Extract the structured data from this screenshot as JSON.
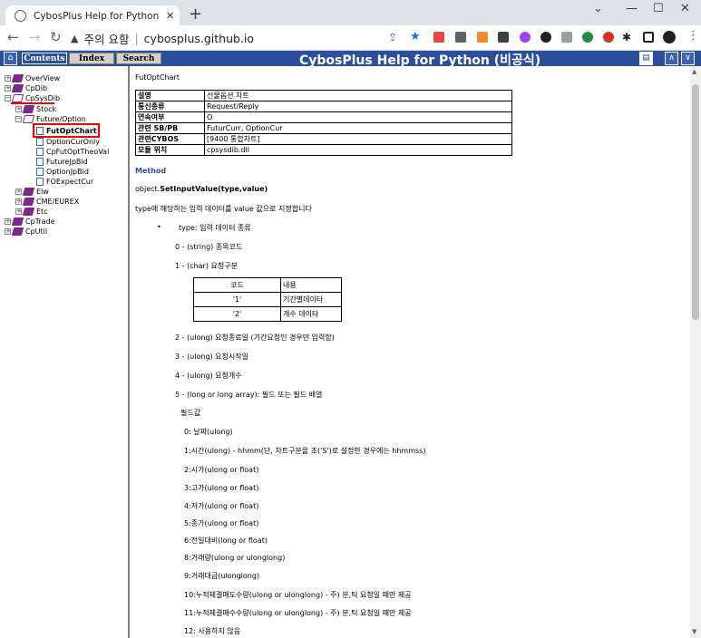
{
  "browser": {
    "tab_title": "CybosPlus Help for Python (비공",
    "tab_close": "✕",
    "new_tab": "+",
    "url_warning": "주의 요함",
    "url": "cybosplus.github.io"
  },
  "help": {
    "tabs": [
      "Contents",
      "Index",
      "Search"
    ],
    "title": "CybosPlus Help for Python (비공식)"
  },
  "tree": [
    {
      "label": "OverView",
      "type": "book",
      "pm": "+"
    },
    {
      "label": "CpDib",
      "type": "book",
      "pm": "+"
    },
    {
      "label": "CpSysDib",
      "type": "open",
      "pm": "−"
    },
    {
      "label": "Stock",
      "type": "book",
      "pm": "+"
    },
    {
      "label": "Future/Option",
      "type": "open",
      "pm": "−"
    },
    {
      "label": "FutOptChart",
      "type": "page"
    },
    {
      "label": "OptionCurOnly",
      "type": "page"
    },
    {
      "label": "CpFutOptTheoVal",
      "type": "page"
    },
    {
      "label": "FutureJpBid",
      "type": "page"
    },
    {
      "label": "OptionJpBid",
      "type": "page"
    },
    {
      "label": "FOExpectCur",
      "type": "page"
    },
    {
      "label": "Elw",
      "type": "book",
      "pm": "+"
    },
    {
      "label": "CME/EUREX",
      "type": "book",
      "pm": "+"
    },
    {
      "label": "Etc",
      "type": "book",
      "pm": "+"
    },
    {
      "label": "CpTrade",
      "type": "book",
      "pm": "+"
    },
    {
      "label": "CpUtil",
      "type": "book",
      "pm": "+"
    }
  ],
  "content": {
    "page_title": "FutOptChart",
    "info_rows": [
      [
        "설명",
        "선물옵션 차트"
      ],
      [
        "통신종류",
        "Request/Reply"
      ],
      [
        "연속여부",
        "O"
      ],
      [
        "관련 SB/PB",
        "FuturCurr, OptionCur"
      ],
      [
        "관련CYBOS",
        "[9400 통합차트]"
      ],
      [
        "모듈 위치",
        "cpsysdib.dll"
      ]
    ],
    "method_heading": "Method",
    "method_prefix": "object.",
    "method_name": "SetInputValue(type,value)",
    "method_desc": "type에 해당하는 입력 데이터를 value 값으로 지정합니다",
    "bullet_type": "type: 입력 데이터 종류",
    "type0": "0 - (string) 종목코드",
    "type1": "1 - (char) 요청구분",
    "codes": [
      [
        "코드",
        "내용"
      ],
      [
        "'1'",
        "기간별데이타"
      ],
      [
        "'2'",
        "개수 데이타"
      ]
    ],
    "type2": "2 - (ulong) 요청종료일 (기간요청인 경우만 입력함)",
    "type3": "3 - (ulong) 요청시작일",
    "type4": "4 - (ulong) 요청개수",
    "type5": "5 - (long or long array): 필드 또는 필드 배열",
    "field_heading": "필드값",
    "fields": [
      "0: 날짜(ulong)",
      "1:시간(ulong) - hhmm(단, 차트구분을 초('S')로 설정한 경우에는 hhmmss)",
      "2:시가(ulong or float)",
      "3:고가(ulong or float)",
      "4:저가(ulong or float)",
      "5:종가(ulong or float)",
      "6:전일대비(long or float)",
      "8:거래량(ulong or ulonglong)",
      "9:거래대금(ulonglong)",
      "10:누적체결매도수량(ulong or ulonglong) - 주) 분,틱 요청일 때만 제공",
      "11:누적체결매수수량(ulong or ulonglong) - 주) 분,틱 요청일 때만 제공",
      "12: 사용하지 않음"
    ]
  },
  "colors": {
    "header_blue": "#2b4f9c",
    "highlight_red": "#e00000",
    "tree_book": "#7b2a8b"
  }
}
